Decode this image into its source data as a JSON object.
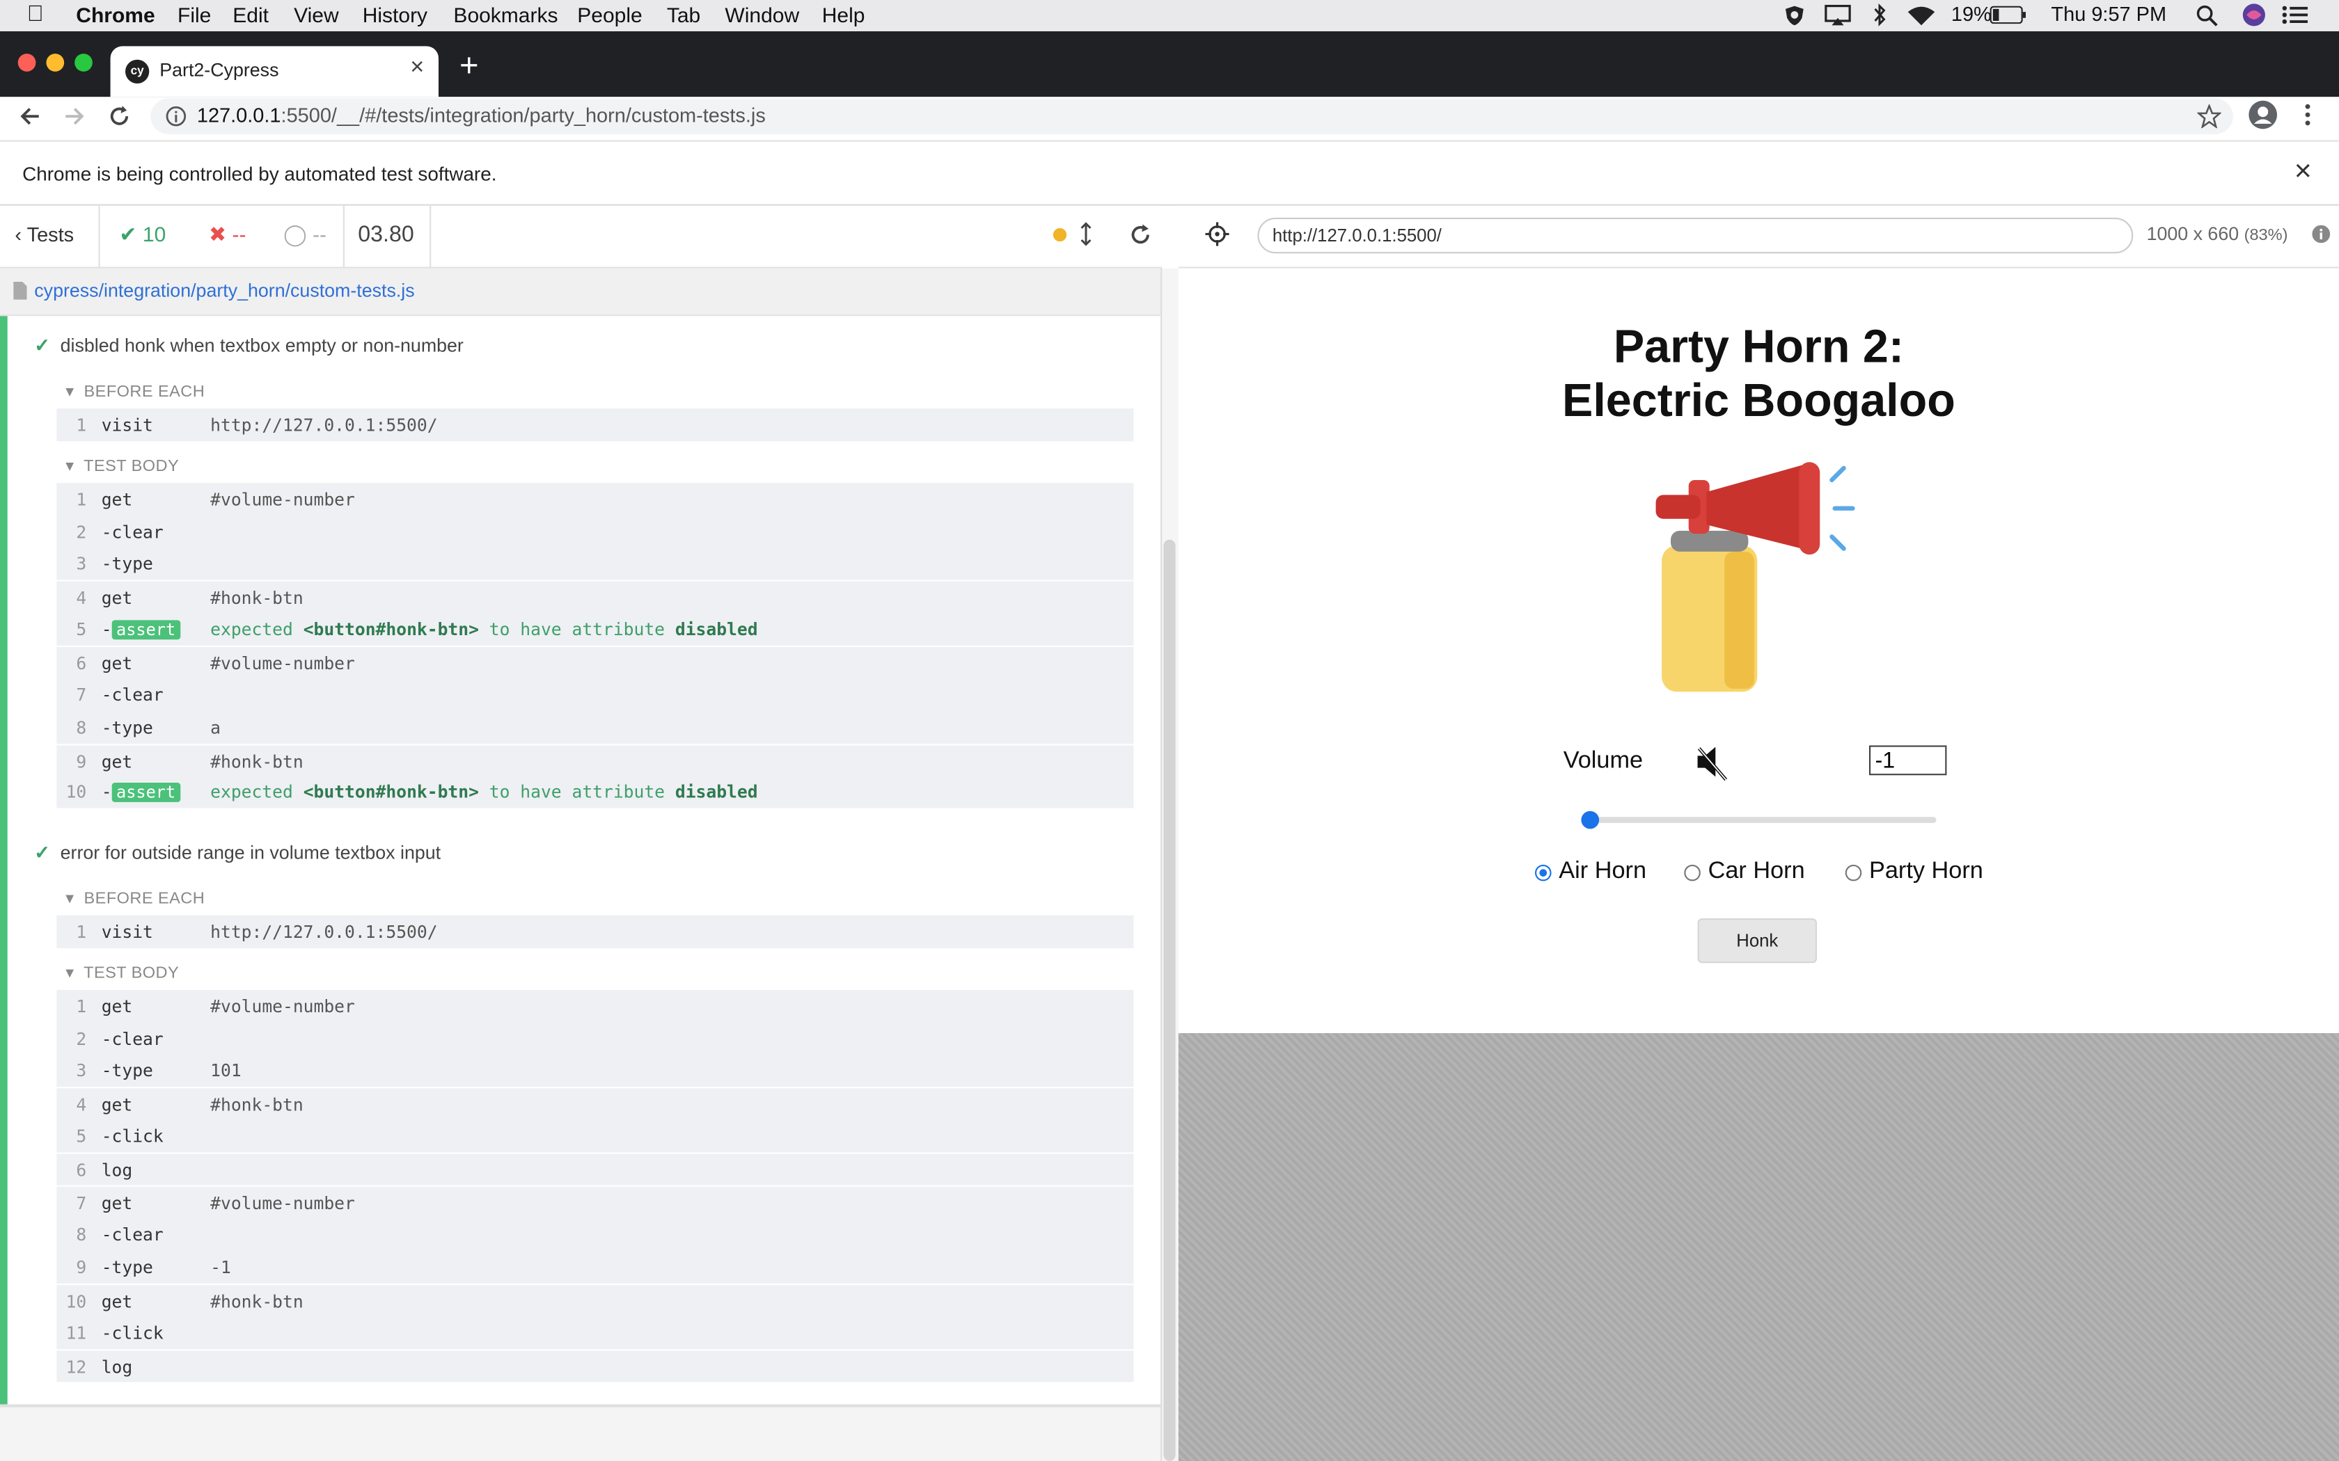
{
  "menubar": {
    "app": "Chrome",
    "items": [
      "File",
      "Edit",
      "View",
      "History",
      "Bookmarks",
      "People",
      "Tab",
      "Window",
      "Help"
    ],
    "battery": "19%",
    "clock": "Thu 9:57 PM"
  },
  "browser": {
    "tab_title": "Part2-Cypress",
    "url_host": "127.0.0.1",
    "url_rest": ":5500/__/#/tests/integration/party_horn/custom-tests.js",
    "infobar_text": "Chrome is being controlled by automated test software."
  },
  "reporter": {
    "back_label": "Tests",
    "passed": "10",
    "failed": "--",
    "pending": "--",
    "duration": "03.80",
    "spec_path": "cypress/integration/party_horn/custom-tests.js",
    "tests": [
      {
        "title": "disbled honk when textbox empty or non-number",
        "before_each_label": "BEFORE EACH",
        "before_each": [
          {
            "n": "1",
            "name": "visit",
            "msg": "http://127.0.0.1:5500/"
          }
        ],
        "body_label": "TEST BODY",
        "body": [
          {
            "n": "1",
            "name": "get",
            "msg": "#volume-number"
          },
          {
            "n": "2",
            "name": "-clear",
            "msg": ""
          },
          {
            "n": "3",
            "name": "-type",
            "msg": ""
          },
          {
            "n": "4",
            "name": "get",
            "msg": "#honk-btn"
          },
          {
            "n": "5",
            "name": "-assert",
            "badge": "assert",
            "msg_expected": "expected",
            "msg_subject": "<button#honk-btn>",
            "msg_to": "to have attribute",
            "msg_attr": "disabled"
          },
          {
            "n": "6",
            "name": "get",
            "msg": "#volume-number"
          },
          {
            "n": "7",
            "name": "-clear",
            "msg": ""
          },
          {
            "n": "8",
            "name": "-type",
            "msg": "a"
          },
          {
            "n": "9",
            "name": "get",
            "msg": "#honk-btn"
          },
          {
            "n": "10",
            "name": "-assert",
            "badge": "assert",
            "msg_expected": "expected",
            "msg_subject": "<button#honk-btn>",
            "msg_to": "to have attribute",
            "msg_attr": "disabled"
          }
        ]
      },
      {
        "title": "error for outside range in volume textbox input",
        "before_each_label": "BEFORE EACH",
        "before_each": [
          {
            "n": "1",
            "name": "visit",
            "msg": "http://127.0.0.1:5500/"
          }
        ],
        "body_label": "TEST BODY",
        "body": [
          {
            "n": "1",
            "name": "get",
            "msg": "#volume-number"
          },
          {
            "n": "2",
            "name": "-clear",
            "msg": ""
          },
          {
            "n": "3",
            "name": "-type",
            "msg": "101"
          },
          {
            "n": "4",
            "name": "get",
            "msg": "#honk-btn"
          },
          {
            "n": "5",
            "name": "-click",
            "msg": ""
          },
          {
            "n": "6",
            "name": "log",
            "msg": ""
          },
          {
            "n": "7",
            "name": "get",
            "msg": "#volume-number"
          },
          {
            "n": "8",
            "name": "-clear",
            "msg": ""
          },
          {
            "n": "9",
            "name": "-type",
            "msg": "-1"
          },
          {
            "n": "10",
            "name": "get",
            "msg": "#honk-btn"
          },
          {
            "n": "11",
            "name": "-click",
            "msg": ""
          },
          {
            "n": "12",
            "name": "log",
            "msg": ""
          }
        ]
      }
    ]
  },
  "aut": {
    "url": "http://127.0.0.1:5500/",
    "viewport": "1000 x 660",
    "scale": "(83%)",
    "title_line1": "Party Horn 2:",
    "title_line2": "Electric Boogaloo",
    "volume_label": "Volume",
    "volume_value": "-1",
    "slider_level": 0,
    "radios": [
      {
        "label": "Air Horn",
        "checked": true
      },
      {
        "label": "Car Horn",
        "checked": false
      },
      {
        "label": "Party Horn",
        "checked": false
      }
    ],
    "honk_label": "Honk"
  },
  "colors": {
    "pass": "#4bc17a",
    "fail": "#e94f4f",
    "accent": "#1a73e8"
  }
}
